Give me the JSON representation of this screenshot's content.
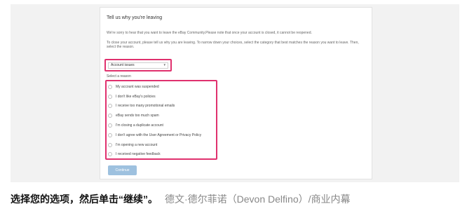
{
  "form": {
    "title": "Tell us why you're leaving",
    "intro": "We're sorry to hear that you want to leave the eBay Community.Please note that once your account is closed, it cannot be reopened.",
    "instructions": "To close your account, please tell us why you are leaving. To narrow down your choices, select the category that best matches the reason you want to leave. Then, select the reason.",
    "category_value": "Account issues",
    "select_label": "Select a reason",
    "reasons": [
      "My account was suspended",
      "I don't like eBay's policies",
      "I receive too many promotional emails",
      "eBay sends too much spam",
      "I'm closing a duplicate account",
      "I don't agree with the User Agreement or Privacy Policy",
      "I'm opening a new account",
      "I received negative feedback"
    ],
    "continue_label": "Continue"
  },
  "caption": {
    "main": "选择您的选项，然后单击“继续”。",
    "credit": "德文·德尔菲诺（Devon Delfino）/商业内幕"
  },
  "colors": {
    "highlight": "#e0316e",
    "button": "#9ec1df"
  }
}
